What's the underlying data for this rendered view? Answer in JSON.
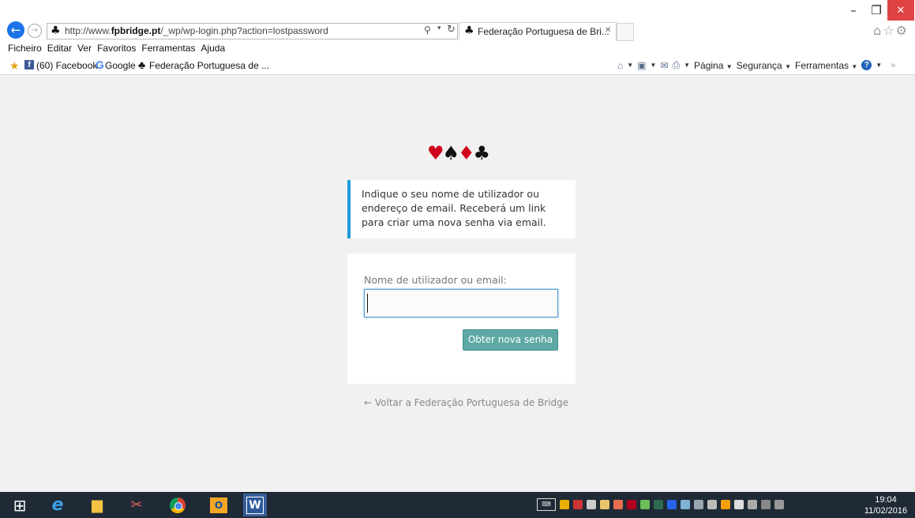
{
  "window": {
    "minimize_icon": "minimize-icon",
    "maximize_icon": "restore-icon",
    "close_icon": "close-icon"
  },
  "browser": {
    "url_prefix": "http://www.",
    "url_domain": "fpbridge.pt",
    "url_path": "/_wp/wp-login.php?action=lostpassword",
    "tab_title": "Federação Portuguesa de Bri...",
    "menu": [
      "Ficheiro",
      "Editar",
      "Ver",
      "Favoritos",
      "Ferramentas",
      "Ajuda"
    ],
    "favorites": [
      {
        "label": "(60) Facebook",
        "icon": "facebook-icon"
      },
      {
        "label": "Google",
        "icon": "google-icon"
      },
      {
        "label": "Federação Portuguesa de ...",
        "icon": "club-icon"
      }
    ],
    "command_bar": {
      "page": "Página",
      "security": "Segurança",
      "tools": "Ferramentas"
    }
  },
  "page": {
    "logo_suits": [
      "♥",
      "♠",
      "♦",
      "♣"
    ],
    "message": "Indique o seu nome de utilizador ou endereço de email. Receberá um link para criar uma nova senha via email.",
    "form": {
      "username_label": "Nome de utilizador ou email:",
      "username_value": "",
      "submit_label": "Obter nova senha"
    },
    "back_link": "← Voltar a Federação Portuguesa de Bridge",
    "colors": {
      "background": "#f1f1f1",
      "message_border": "#1e9bd7",
      "button": "#5ea9a4",
      "suit_red": "#d0021b"
    }
  },
  "taskbar": {
    "apps": [
      "windows-start-icon",
      "internet-explorer-icon",
      "file-explorer-icon",
      "snipping-tool-icon",
      "chrome-icon",
      "outlook-icon",
      "word-icon"
    ],
    "time": "19:04",
    "date": "11/02/2016"
  }
}
